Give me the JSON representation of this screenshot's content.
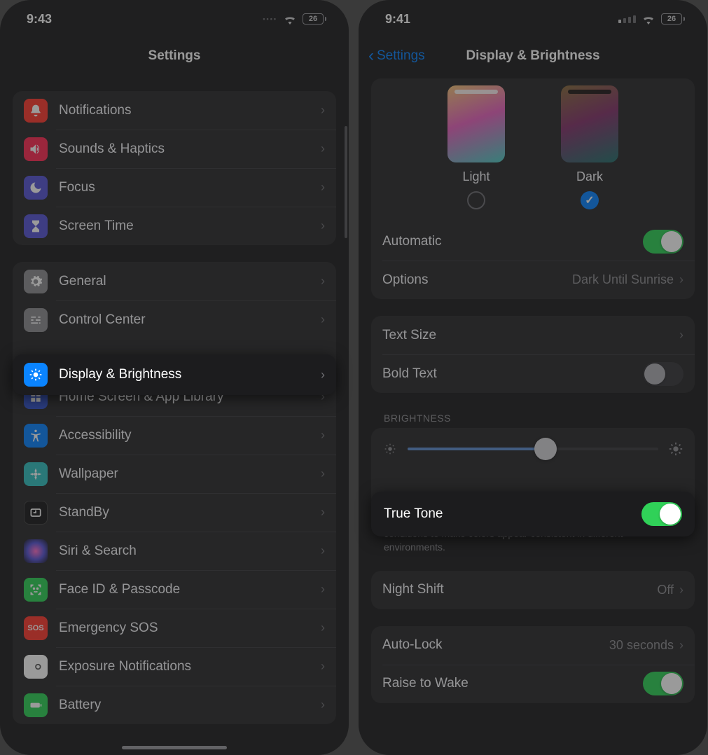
{
  "left": {
    "status": {
      "time": "9:43",
      "battery": "26"
    },
    "title": "Settings",
    "group1": [
      {
        "name": "notifications",
        "label": "Notifications",
        "color": "#ff3b30"
      },
      {
        "name": "sounds",
        "label": "Sounds & Haptics",
        "color": "#ff2d55"
      },
      {
        "name": "focus",
        "label": "Focus",
        "color": "#5856d6"
      },
      {
        "name": "screentime",
        "label": "Screen Time",
        "color": "#5856d6"
      }
    ],
    "group2": [
      {
        "name": "general",
        "label": "General",
        "color": "#8e8e93"
      },
      {
        "name": "controlcenter",
        "label": "Control Center",
        "color": "#8e8e93"
      },
      {
        "name": "display",
        "label": "Display & Brightness",
        "color": "#0a84ff",
        "highlight": true
      },
      {
        "name": "homescreen",
        "label": "Home Screen & App Library",
        "color": "#3355cc"
      },
      {
        "name": "accessibility",
        "label": "Accessibility",
        "color": "#0a84ff"
      },
      {
        "name": "wallpaper",
        "label": "Wallpaper",
        "color": "#34c2c2"
      },
      {
        "name": "standby",
        "label": "StandBy",
        "color": "#1c1c1e"
      },
      {
        "name": "siri",
        "label": "Siri & Search",
        "color": "#3a3a3c"
      },
      {
        "name": "faceid",
        "label": "Face ID & Passcode",
        "color": "#30d158"
      },
      {
        "name": "sos",
        "label": "Emergency SOS",
        "color": "#ff3b30"
      },
      {
        "name": "exposure",
        "label": "Exposure Notifications",
        "color": "#ffffff"
      },
      {
        "name": "battery",
        "label": "Battery",
        "color": "#30d158"
      }
    ]
  },
  "right": {
    "status": {
      "time": "9:41",
      "battery": "26"
    },
    "back": "Settings",
    "title": "Display & Brightness",
    "appearance": {
      "light": "Light",
      "dark": "Dark",
      "selected": "dark"
    },
    "rows": {
      "automatic": "Automatic",
      "options": "Options",
      "options_value": "Dark Until Sunrise",
      "text_size": "Text Size",
      "bold_text": "Bold Text",
      "brightness_header": "Brightness",
      "true_tone": "True Tone",
      "true_tone_desc": "Automatically adapt iPhone display based on ambient lighting conditions to make colors appear consistent in different environments.",
      "night_shift": "Night Shift",
      "night_shift_value": "Off",
      "auto_lock": "Auto-Lock",
      "auto_lock_value": "30 seconds",
      "raise_to_wake": "Raise to Wake"
    },
    "brightness_percent": 55
  }
}
